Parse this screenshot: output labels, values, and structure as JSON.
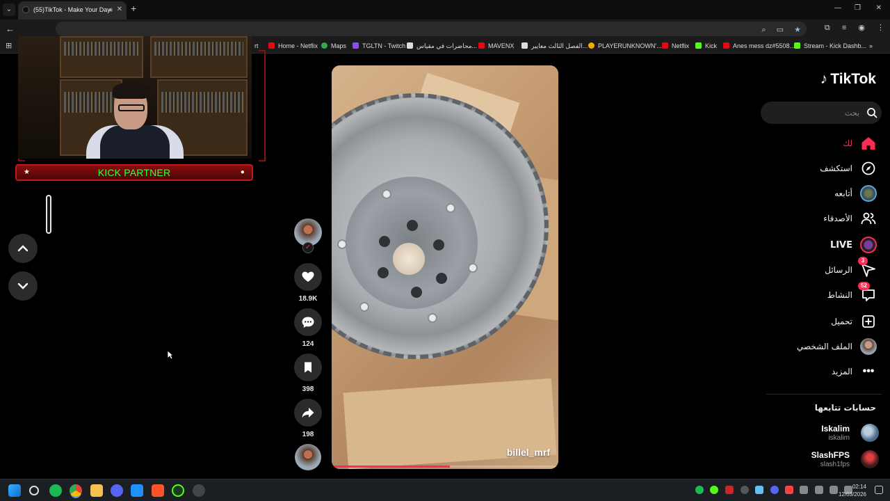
{
  "browser": {
    "tab_title": "(55)TikTok - Make Your Day",
    "bookmarks": [
      {
        "label": "rt",
        "color": "#888888"
      },
      {
        "label": "Home - Netflix",
        "color": "#e50914"
      },
      {
        "label": "Maps",
        "color": "#34a853"
      },
      {
        "label": "TGLTN - Twitch",
        "color": "#9146ff"
      },
      {
        "label": "محاضرات في مقياس...",
        "color": "#dddddd"
      },
      {
        "label": "MAVENX",
        "color": "#e50914"
      },
      {
        "label": "الفصل الثالث معايير...",
        "color": "#dddddd"
      },
      {
        "label": "PLAYERUNKNOWN'...",
        "color": "#f2a900"
      },
      {
        "label": "Netflix",
        "color": "#e50914"
      },
      {
        "label": "Kick",
        "color": "#53fc18"
      },
      {
        "label": "Anes mess dz#5508...",
        "color": "#e50914"
      },
      {
        "label": "Stream - Kick Dashb...",
        "color": "#53fc18"
      }
    ],
    "bookmarks_more": "»"
  },
  "overlay": {
    "banner_text": "KICK PARTNER"
  },
  "video": {
    "username": "billel_mrf",
    "progress": 0.52
  },
  "actions": {
    "likes": "18.9K",
    "comments": "124",
    "saves": "398",
    "shares": "198"
  },
  "sidebar": {
    "logo": "TikTok",
    "search_placeholder": "بحث",
    "items": [
      {
        "label": "لك",
        "icon": "home-icon",
        "active": true
      },
      {
        "label": "استكشف",
        "icon": "compass-icon"
      },
      {
        "label": "أتابعه",
        "icon": "following-avatar-icon"
      },
      {
        "label": "الأصدقاء",
        "icon": "friends-icon"
      },
      {
        "label": "LIVE",
        "icon": "live-icon"
      },
      {
        "label": "الرسائل",
        "icon": "send-icon",
        "badge": "3"
      },
      {
        "label": "النشاط",
        "icon": "activity-icon",
        "badge": "52"
      },
      {
        "label": "تحميل",
        "icon": "upload-icon"
      },
      {
        "label": "الملف الشخصي",
        "icon": "profile-avatar-icon"
      },
      {
        "label": "المزيد",
        "icon": "more-icon"
      }
    ],
    "following_title": "حسابات تتابعها",
    "following": [
      {
        "name": "Iskalim",
        "handle": "iskalim"
      },
      {
        "name": "SlashFPS",
        "handle": "slash1fps"
      }
    ]
  },
  "taskbar": {
    "time": "02:14",
    "date": "12/03/2026"
  },
  "colors": {
    "accent": "#fe2c55",
    "kick_green": "#3cff3c"
  }
}
